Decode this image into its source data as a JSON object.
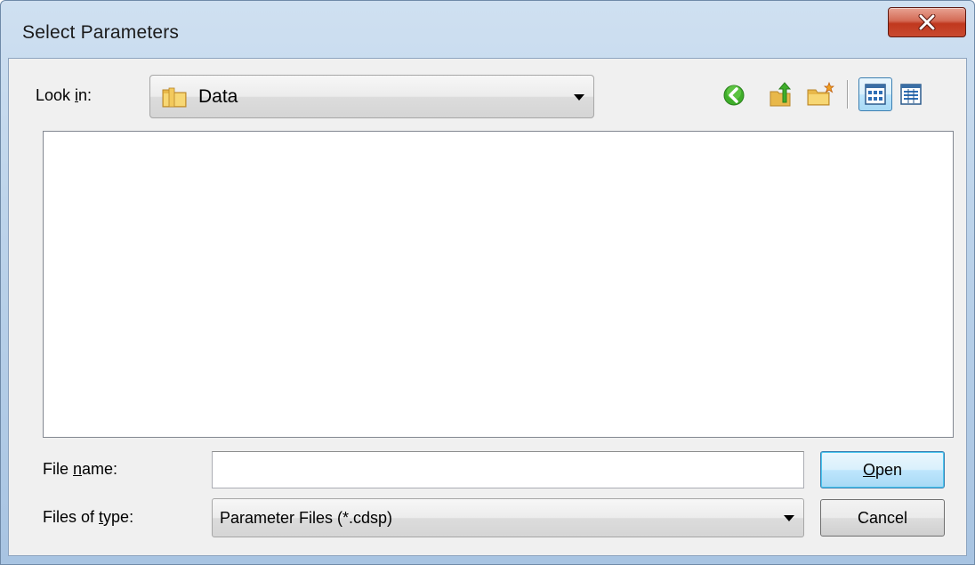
{
  "window": {
    "title": "Select Parameters"
  },
  "look_in": {
    "label_pre": "Look ",
    "label_access": "i",
    "label_post": "n:",
    "value": "Data"
  },
  "toolbar": {
    "icons": [
      "back-icon",
      "up-folder-icon",
      "new-folder-icon",
      "list-view-icon",
      "details-view-icon"
    ]
  },
  "file_name": {
    "label_pre": "File ",
    "label_access": "n",
    "label_post": "ame:",
    "value": ""
  },
  "file_type": {
    "label_pre": "Files of ",
    "label_access": "t",
    "label_post": "ype:",
    "value": "Parameter Files (*.cdsp)"
  },
  "buttons": {
    "open_access": "O",
    "open_rest": "pen",
    "cancel": "Cancel"
  },
  "colors": {
    "close_button": "#c94a30",
    "back_arrow": "#3fae2a",
    "selection": "#3c7fb1"
  }
}
